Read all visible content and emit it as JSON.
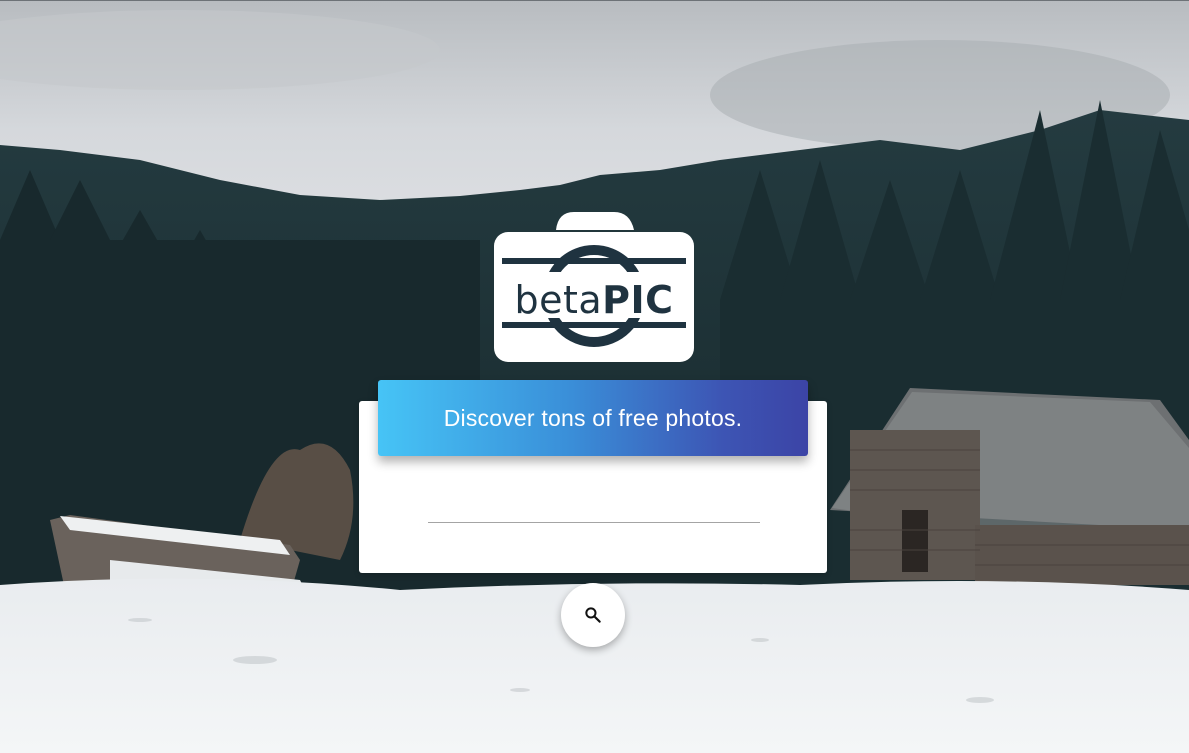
{
  "logo": {
    "text_light": "beta",
    "text_bold": "PIC"
  },
  "hero": {
    "tagline": "Discover tons of free photos."
  },
  "search": {
    "value": "",
    "button_icon": "search-icon"
  },
  "background": {
    "icon": "snowy-forest-cabin-photo"
  },
  "colors": {
    "banner_start": "#46c4f6",
    "banner_end": "#3c44a6",
    "logo_dark": "#1f3340"
  }
}
